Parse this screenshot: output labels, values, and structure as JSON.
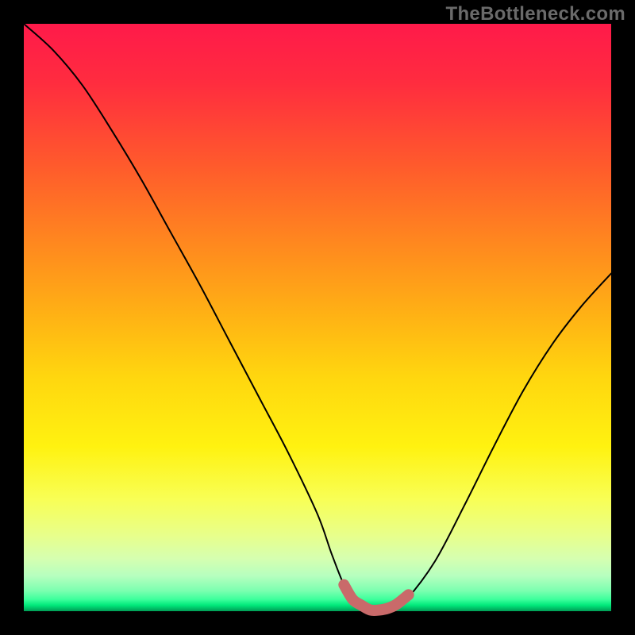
{
  "watermark": "TheBottleneck.com",
  "chart_data": {
    "type": "line",
    "title": "",
    "xlabel": "",
    "ylabel": "",
    "xlim": [
      0,
      1
    ],
    "ylim": [
      0,
      1
    ],
    "x": [
      0.0,
      0.05,
      0.1,
      0.15,
      0.2,
      0.25,
      0.3,
      0.35,
      0.4,
      0.45,
      0.5,
      0.525,
      0.55,
      0.575,
      0.6,
      0.625,
      0.65,
      0.7,
      0.75,
      0.8,
      0.85,
      0.9,
      0.95,
      1.0
    ],
    "values": [
      1.0,
      0.955,
      0.895,
      0.818,
      0.735,
      0.645,
      0.555,
      0.46,
      0.365,
      0.27,
      0.165,
      0.095,
      0.035,
      0.01,
      0.0,
      0.0,
      0.018,
      0.085,
      0.18,
      0.28,
      0.375,
      0.455,
      0.52,
      0.575
    ],
    "highlight_segment": {
      "x": [
        0.545,
        0.56,
        0.575,
        0.59,
        0.605,
        0.62,
        0.635,
        0.655
      ],
      "values": [
        0.045,
        0.02,
        0.01,
        0.002,
        0.002,
        0.005,
        0.012,
        0.028
      ]
    },
    "background_gradient": {
      "top": "#ff1a4a",
      "mid": "#ffd60f",
      "bottom": "#009c56"
    }
  }
}
